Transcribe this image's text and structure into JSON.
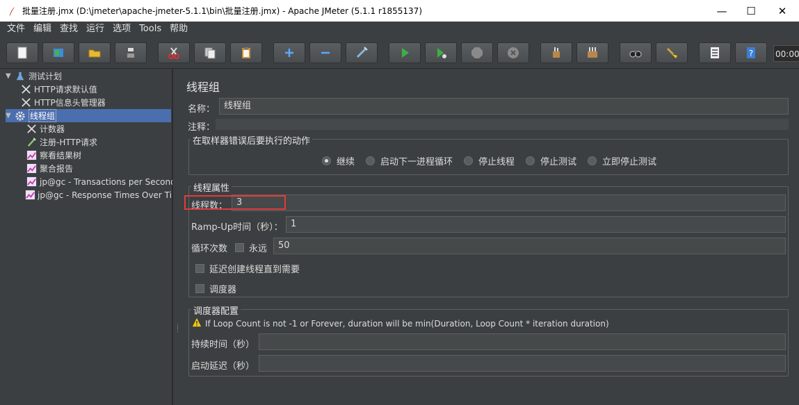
{
  "window": {
    "title": "批量注册.jmx (D:\\jmeter\\apache-jmeter-5.1.1\\bin\\批量注册.jmx) - Apache JMeter (5.1.1 r1855137)"
  },
  "menu": [
    "文件",
    "编辑",
    "查找",
    "运行",
    "选项",
    "Tools",
    "帮助"
  ],
  "toolbar": {
    "timer": "00:00:"
  },
  "tree": {
    "root": "测试计划",
    "items": [
      "HTTP请求默认值",
      "HTTP信息头管理器",
      "线程组",
      "计数器",
      "注册-HTTP请求",
      "察看结果树",
      "聚合报告",
      "jp@gc - Transactions per Second",
      "jp@gc - Response Times Over Time"
    ]
  },
  "panel": {
    "title": "线程组",
    "name_label": "名称：",
    "name_value": "线程组",
    "comment_label": "注释：",
    "sampler_error": {
      "legend": "在取样器错误后要执行的动作",
      "options": [
        "继续",
        "启动下一进程循环",
        "停止线程",
        "停止测试",
        "立即停止测试"
      ],
      "selected": "继续"
    },
    "thread_props": {
      "legend": "线程属性",
      "threads_label": "线程数：",
      "threads_value": "3",
      "rampup_label": "Ramp-Up时间（秒）：",
      "rampup_value": "1",
      "loop_label": "循环次数",
      "forever_label": "永远",
      "loop_value": "50",
      "delay_label": "延迟创建线程直到需要",
      "scheduler_label": "调度器"
    },
    "scheduler_config": {
      "legend": "调度器配置",
      "warning": "If Loop Count is not -1 or Forever, duration will be min(Duration, Loop Count * iteration duration)",
      "duration_label": "持续时间（秒）",
      "delay_label": "启动延迟（秒）"
    }
  }
}
